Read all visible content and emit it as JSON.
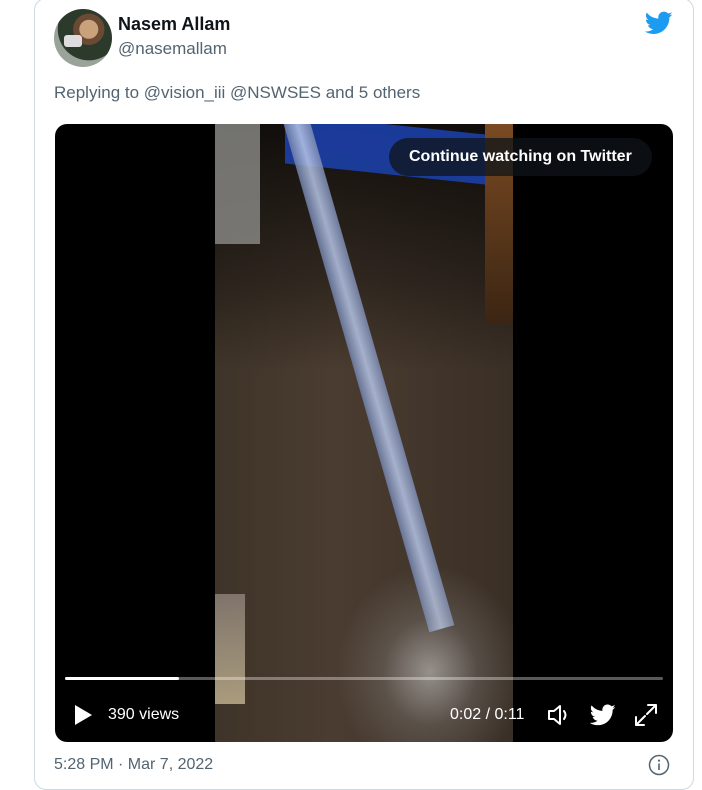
{
  "tweet": {
    "author_name": "Nasem Allam",
    "author_handle": "@nasemallam",
    "reply_prefix": "Replying to",
    "reply_targets": "@vision_iii @NSWSES",
    "reply_suffix": "and 5 others",
    "timestamp": "5:28 PM · Mar 7, 2022"
  },
  "video": {
    "continue_label": "Continue watching on Twitter",
    "views": "390 views",
    "time": "0:02 / 0:11",
    "progress": 0.19
  },
  "icons": {
    "brand": "twitter-bird-icon",
    "play": "play-icon",
    "volume": "volume-icon",
    "share": "twitter-bird-icon",
    "fullscreen": "fullscreen-icon",
    "info": "info-icon"
  },
  "colors": {
    "brand": "#1d9bf0",
    "text": "#0f1419",
    "secondary": "#536471",
    "link": "#1d9bf0"
  }
}
